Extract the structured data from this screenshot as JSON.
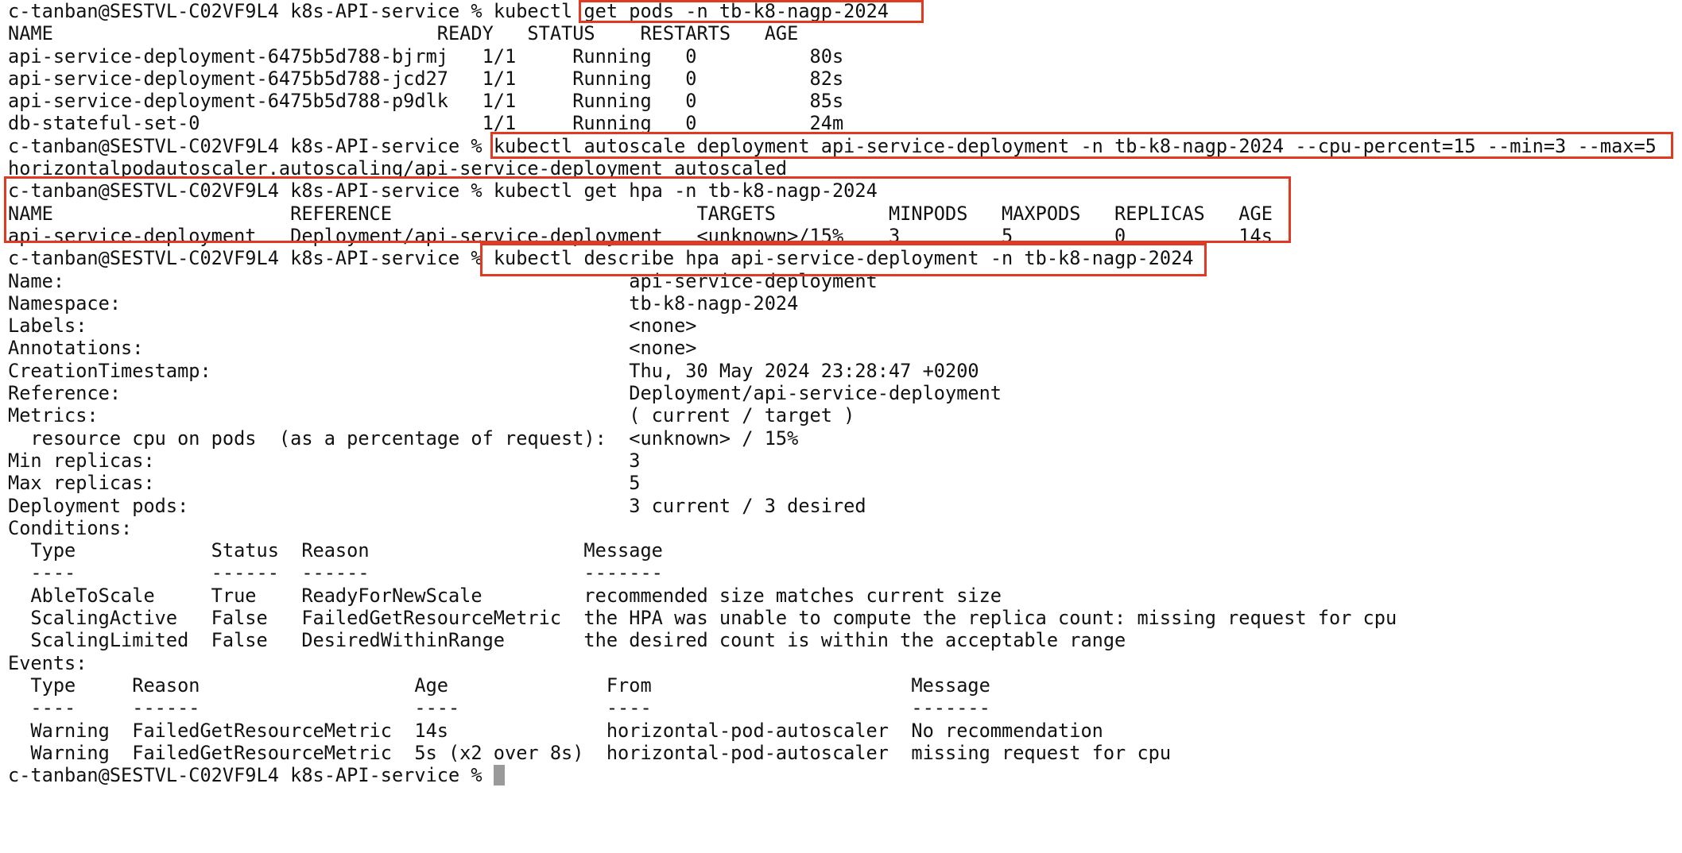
{
  "prompt": "c-tanban@SESTVL-C02VF9L4 k8s-API-service % ",
  "commands": {
    "get_pods": {
      "prefix": "kubectl ",
      "highlighted": "get pods -n tb-k8-nagp-2024"
    },
    "autoscale": "kubectl autoscale deployment api-service-deployment -n tb-k8-nagp-2024 --cpu-percent=15 --min=3 --max=5",
    "get_hpa": "kubectl get hpa -n tb-k8-nagp-2024",
    "describe_hpa": "kubectl describe hpa api-service-deployment -n tb-k8-nagp-2024"
  },
  "pods_table": {
    "header": "NAME                                  READY   STATUS    RESTARTS   AGE",
    "rows": [
      "api-service-deployment-6475b5d788-bjrmj   1/1     Running   0          80s",
      "api-service-deployment-6475b5d788-jcd27   1/1     Running   0          82s",
      "api-service-deployment-6475b5d788-p9dlk   1/1     Running   0          85s",
      "db-stateful-set-0                         1/1     Running   0          24m"
    ]
  },
  "autoscale_output": "horizontalpodautoscaler.autoscaling/api-service-deployment autoscaled",
  "hpa_table": {
    "header": "NAME                     REFERENCE                           TARGETS          MINPODS   MAXPODS   REPLICAS   AGE",
    "row": "api-service-deployment   Deployment/api-service-deployment   <unknown>/15%    3         5         0          14s"
  },
  "describe": {
    "lines": [
      "Name:                                                  api-service-deployment",
      "Namespace:                                             tb-k8-nagp-2024",
      "Labels:                                                <none>",
      "Annotations:                                           <none>",
      "CreationTimestamp:                                     Thu, 30 May 2024 23:28:47 +0200",
      "Reference:                                             Deployment/api-service-deployment",
      "Metrics:                                               ( current / target )",
      "  resource cpu on pods  (as a percentage of request):  <unknown> / 15%",
      "Min replicas:                                          3",
      "Max replicas:                                          5",
      "Deployment pods:                                       3 current / 3 desired",
      "Conditions:",
      "  Type            Status  Reason                   Message",
      "  ----            ------  ------                   -------",
      "  AbleToScale     True    ReadyForNewScale         recommended size matches current size",
      "  ScalingActive   False   FailedGetResourceMetric  the HPA was unable to compute the replica count: missing request for cpu",
      "  ScalingLimited  False   DesiredWithinRange       the desired count is within the acceptable range",
      "Events:",
      "  Type     Reason                   Age              From                       Message",
      "  ----     ------                   ----             ----                       -------",
      "  Warning  FailedGetResourceMetric  14s              horizontal-pod-autoscaler  No recommendation",
      "  Warning  FailedGetResourceMetric  5s (x2 over 8s)  horizontal-pod-autoscaler  missing request for cpu"
    ]
  },
  "colors": {
    "background": "#ffffff",
    "text": "#111111",
    "highlight_border": "#e03a22",
    "cursor": "#9a9a9a"
  }
}
